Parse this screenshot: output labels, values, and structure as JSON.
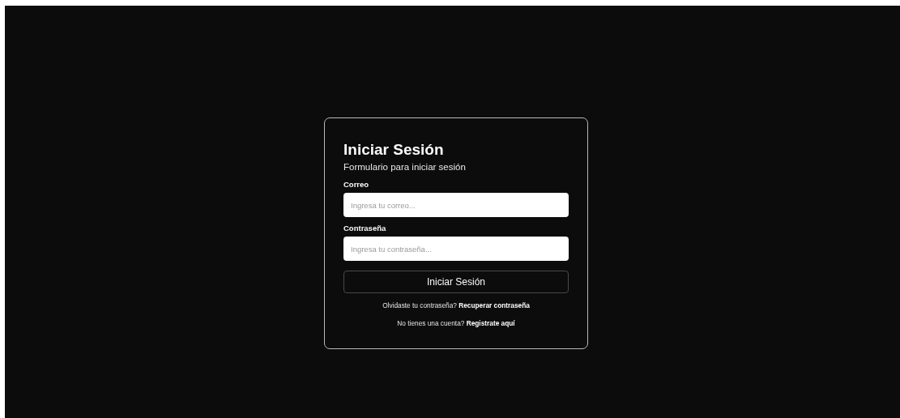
{
  "login": {
    "title": "Iniciar Sesión",
    "subtitle": "Formulario para iniciar sesión",
    "fields": [
      {
        "label": "Correo",
        "placeholder": "Ingresa tu correo..."
      },
      {
        "label": "Contraseña",
        "placeholder": "Ingresa tu contraseña..."
      }
    ],
    "submit": "Iniciar Sesión",
    "links": [
      {
        "text": "Olvidaste tu contraseña?",
        "link": "Recuperar contraseña"
      },
      {
        "text": "No tienes una cuenta?",
        "link": "Registrate aquí"
      }
    ]
  }
}
